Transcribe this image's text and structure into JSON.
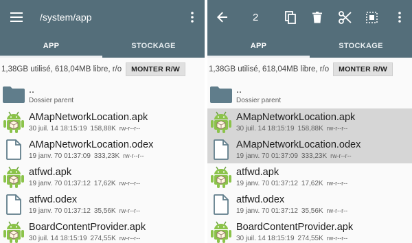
{
  "left": {
    "path": "/system/app",
    "tabs": [
      "APP",
      "STOCKAGE"
    ],
    "storage_info": "1,38GB utilisé, 618,04MB libre, r/o",
    "mount_button": "MONTER R/W",
    "items": [
      {
        "icon": "folder-icon",
        "name": "..",
        "sub": "Dossier parent",
        "date": "",
        "size": "",
        "perm": ""
      },
      {
        "icon": "android-apk-icon",
        "name": "AMapNetworkLocation.apk",
        "date": "30 juil. 14 18:15:19",
        "size": "158,88K",
        "perm": "rw-r--r--"
      },
      {
        "icon": "file-icon",
        "name": "AMapNetworkLocation.odex",
        "date": "19 janv. 70 01:37:09",
        "size": "333,23K",
        "perm": "rw-r--r--"
      },
      {
        "icon": "android-apk-icon",
        "name": "atfwd.apk",
        "date": "19 janv. 70 01:37:12",
        "size": "17,62K",
        "perm": "rw-r--r--"
      },
      {
        "icon": "file-icon",
        "name": "atfwd.odex",
        "date": "19 janv. 70 01:37:12",
        "size": "35,56K",
        "perm": "rw-r--r--"
      },
      {
        "icon": "android-apk-icon",
        "name": "BoardContentProvider.apk",
        "date": "30 juil. 14 18:15:19",
        "size": "274,55K",
        "perm": "rw-r--r--"
      }
    ]
  },
  "right": {
    "selected_count": "2",
    "tabs": [
      "APP",
      "STOCKAGE"
    ],
    "storage_info": "1,38GB utilisé, 618,04MB libre, r/o",
    "mount_button": "MONTER R/W",
    "items": [
      {
        "icon": "folder-icon",
        "name": "..",
        "sub": "Dossier parent",
        "date": "",
        "size": "",
        "perm": ""
      },
      {
        "icon": "android-apk-icon",
        "name": "AMapNetworkLocation.apk",
        "date": "30 juil. 14 18:15:19",
        "size": "158,88K",
        "perm": "rw-r--r--",
        "selected": true
      },
      {
        "icon": "file-icon",
        "name": "AMapNetworkLocation.odex",
        "date": "19 janv. 70 01:37:09",
        "size": "333,23K",
        "perm": "rw-r--r--",
        "selected": true
      },
      {
        "icon": "android-apk-icon",
        "name": "atfwd.apk",
        "date": "19 janv. 70 01:37:12",
        "size": "17,62K",
        "perm": "rw-r--r--"
      },
      {
        "icon": "file-icon",
        "name": "atfwd.odex",
        "date": "19 janv. 70 01:37:12",
        "size": "35,56K",
        "perm": "rw-r--r--"
      },
      {
        "icon": "android-apk-icon",
        "name": "BoardContentProvider.apk",
        "date": "30 juil. 14 18:15:19",
        "size": "274,55K",
        "perm": "rw-r--r--"
      }
    ]
  },
  "colors": {
    "toolbar": "#546e7a",
    "selection": "#d6d6d6",
    "android_green": "#8bc34a",
    "folder": "#607d8b"
  }
}
